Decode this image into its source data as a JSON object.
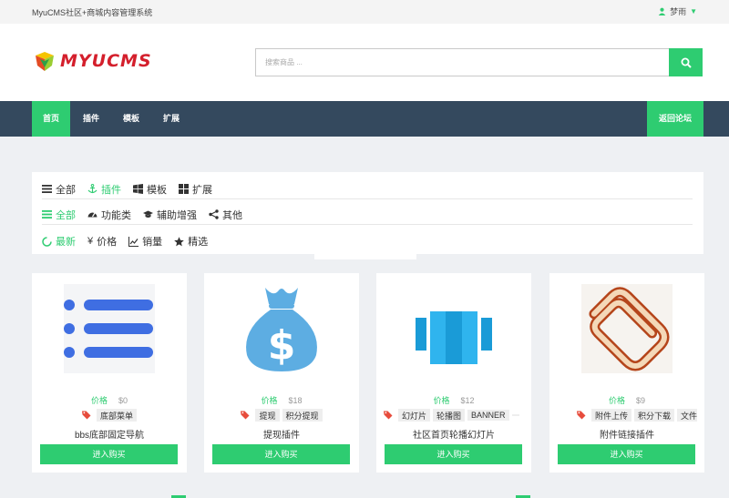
{
  "topbar": {
    "site_title": "MyuCMS社区+商城内容管理系统",
    "user_name": "梦雨",
    "user_icon": "user-icon",
    "dropdown_icon": "caret-down-icon"
  },
  "header": {
    "logo_text": "MYUCMS",
    "search": {
      "placeholder": "搜索商品 ...",
      "value": "",
      "button_icon": "search-icon"
    }
  },
  "nav": {
    "items": [
      {
        "label": "首页",
        "active": true
      },
      {
        "label": "插件",
        "active": false
      },
      {
        "label": "模板",
        "active": false
      },
      {
        "label": "扩展",
        "active": false
      }
    ],
    "forum_label": "返回论坛"
  },
  "filters": {
    "types": [
      {
        "label": "全部",
        "icon": "list-icon",
        "active": false
      },
      {
        "label": "插件",
        "icon": "anchor-icon",
        "active": true
      },
      {
        "label": "模板",
        "icon": "windows-icon",
        "active": false
      },
      {
        "label": "扩展",
        "icon": "grid-icon",
        "active": false
      }
    ],
    "categories": [
      {
        "label": "全部",
        "icon": "list-icon",
        "active": true
      },
      {
        "label": "功能类",
        "icon": "dashboard-icon",
        "active": false
      },
      {
        "label": "辅助增强",
        "icon": "graduation-cap-icon",
        "active": false
      },
      {
        "label": "其他",
        "icon": "share-icon",
        "active": false
      }
    ],
    "sorts": [
      {
        "label": "最新",
        "icon": "spinner-icon",
        "active": true
      },
      {
        "label": "价格",
        "icon": "yen-icon",
        "active": false
      },
      {
        "label": "销量",
        "icon": "line-chart-icon",
        "active": false
      },
      {
        "label": "精选",
        "icon": "star-icon",
        "active": false
      }
    ]
  },
  "products": [
    {
      "image_icon": "list-menu-icon",
      "price_label": "价格",
      "price": "$0",
      "tags": [
        "底部菜单"
      ],
      "title": "bbs底部固定导航",
      "buy_label": "进入购买"
    },
    {
      "image_icon": "money-bag-icon",
      "price_label": "价格",
      "price": "$18",
      "tags": [
        "提现",
        "积分提现"
      ],
      "title": "提现插件",
      "buy_label": "进入购买"
    },
    {
      "image_icon": "slides-icon",
      "price_label": "价格",
      "price": "$12",
      "tags": [
        "幻灯片",
        "轮播图",
        "BANNER",
        " "
      ],
      "title": "社区首页轮播幻灯片",
      "buy_label": "进入购买"
    },
    {
      "image_icon": "paperclip-icon",
      "price_label": "价格",
      "price": "$9",
      "tags": [
        "附件上传",
        "积分下载",
        "文件"
      ],
      "title": "附件链接插件",
      "buy_label": "进入购买"
    }
  ],
  "colors": {
    "accent": "#2ecc71",
    "nav_bg": "#34495e",
    "page_bg": "#eef0f3",
    "logo_red": "#d41f2c",
    "tag_icon": "#e74c3c"
  }
}
